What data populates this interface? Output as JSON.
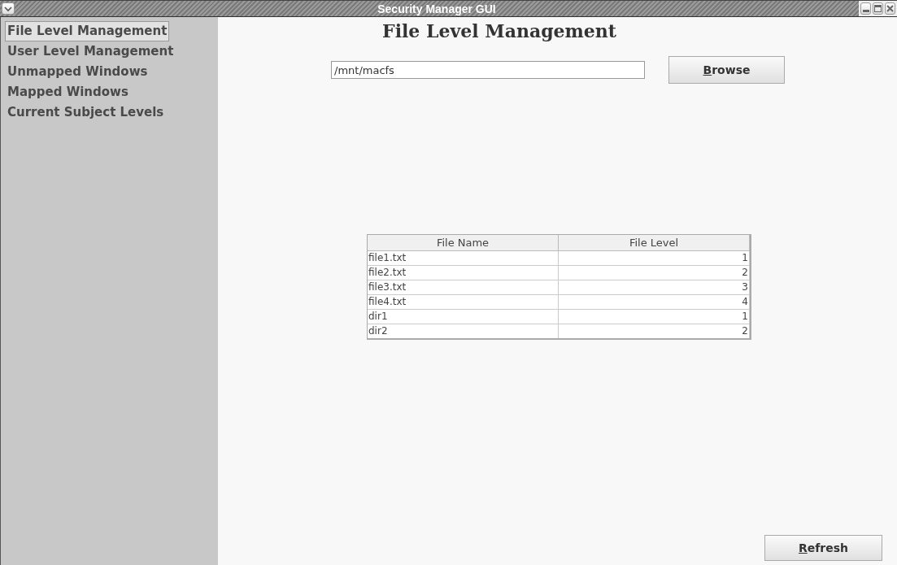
{
  "window": {
    "title": "Security Manager GUI"
  },
  "sidebar": {
    "items": [
      {
        "label": "File Level Management",
        "selected": true
      },
      {
        "label": "User Level Management",
        "selected": false
      },
      {
        "label": "Unmapped Windows",
        "selected": false
      },
      {
        "label": "Mapped Windows",
        "selected": false
      },
      {
        "label": "Current Subject Levels",
        "selected": false
      }
    ]
  },
  "heading": "File Level Management",
  "path_field": {
    "value": "/mnt/macfs"
  },
  "browse_button": "Browse",
  "table": {
    "columns": [
      "File Name",
      "File Level"
    ],
    "rows": [
      [
        "file1.txt",
        "1"
      ],
      [
        "file2.txt",
        "2"
      ],
      [
        "file3.txt",
        "3"
      ],
      [
        "file4.txt",
        "4"
      ],
      [
        "dir1",
        "1"
      ],
      [
        "dir2",
        "2"
      ]
    ]
  },
  "refresh_button": "Refresh"
}
